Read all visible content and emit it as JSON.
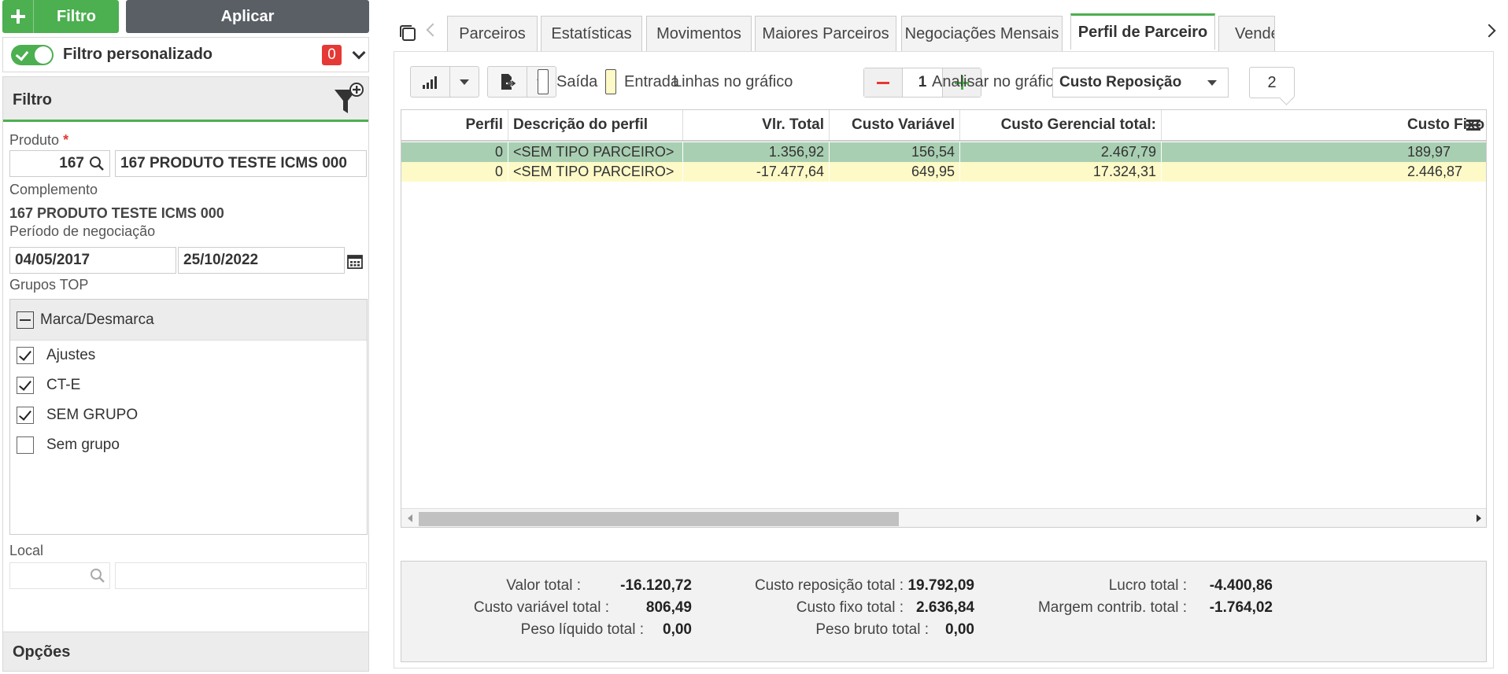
{
  "header": {
    "filter_button": "Filtro",
    "apply_button": "Aplicar"
  },
  "custom_filter": {
    "label": "Filtro personalizado",
    "count": "0"
  },
  "filter_panel": {
    "title": "Filtro",
    "product_label": "Produto",
    "required_marker": "*",
    "product_code": "167",
    "product_name": "167 PRODUTO TESTE ICMS 000",
    "complement_label": "Complemento",
    "complement_value": "167 PRODUTO TESTE ICMS 000",
    "period_label": "Período de negociação",
    "date_start": "04/05/2017",
    "date_end": "25/10/2022",
    "groups_label": "Grupos TOP",
    "groups_toggle_label": "Marca/Desmarca",
    "groups": [
      {
        "label": "Ajustes",
        "checked": true
      },
      {
        "label": "CT-E",
        "checked": true
      },
      {
        "label": "SEM GRUPO",
        "checked": true
      },
      {
        "label": "Sem grupo",
        "checked": false
      }
    ],
    "local_label": "Local",
    "options_label": "Opções"
  },
  "tabs": [
    {
      "label": "Parceiros"
    },
    {
      "label": "Estatísticas"
    },
    {
      "label": "Movimentos"
    },
    {
      "label": "Maiores Parceiros"
    },
    {
      "label": "Negociações Mensais"
    },
    {
      "label": "Perfil de Parceiro",
      "active": true
    },
    {
      "label": "Vendedores"
    }
  ],
  "toolbar": {
    "legend_out": "Saída",
    "legend_in": "Entrada",
    "lines_label": "Linhas no gráfico",
    "lines_value": "1",
    "analyze_label": "Analisar no gráfico",
    "analyze_value": "Custo Reposição",
    "count": "2"
  },
  "grid": {
    "columns": [
      "Perfil",
      "Descrição do perfil",
      "Vlr. Total",
      "Custo Variável",
      "Custo Gerencial total:",
      "Custo Fixo"
    ],
    "rows": [
      [
        "0",
        "<SEM TIPO PARCEIRO>",
        "1.356,92",
        "156,54",
        "2.467,79",
        "189,97"
      ],
      [
        "0",
        "<SEM TIPO PARCEIRO>",
        "-17.477,64",
        "649,95",
        "17.324,31",
        "2.446,87"
      ]
    ]
  },
  "totals": {
    "valor_total_label": "Valor total :",
    "valor_total": "-16.120,72",
    "custo_variavel_label": "Custo variável total :",
    "custo_variavel": "806,49",
    "peso_liquido_label": "Peso líquido total :",
    "peso_liquido": "0,00",
    "custo_reposicao_label": "Custo reposição total :",
    "custo_reposicao": "19.792,09",
    "custo_fixo_label": "Custo fixo total :",
    "custo_fixo": "2.636,84",
    "peso_bruto_label": "Peso bruto total :",
    "peso_bruto": "0,00",
    "lucro_label": "Lucro total :",
    "lucro": "-4.400,86",
    "margem_label": "Margem contrib. total :",
    "margem": "-1.764,02"
  },
  "colors": {
    "accent_green": "#4caf50",
    "row_out": "#a9cfb2",
    "row_in": "#fdfac8",
    "badge_red": "#e53935"
  }
}
